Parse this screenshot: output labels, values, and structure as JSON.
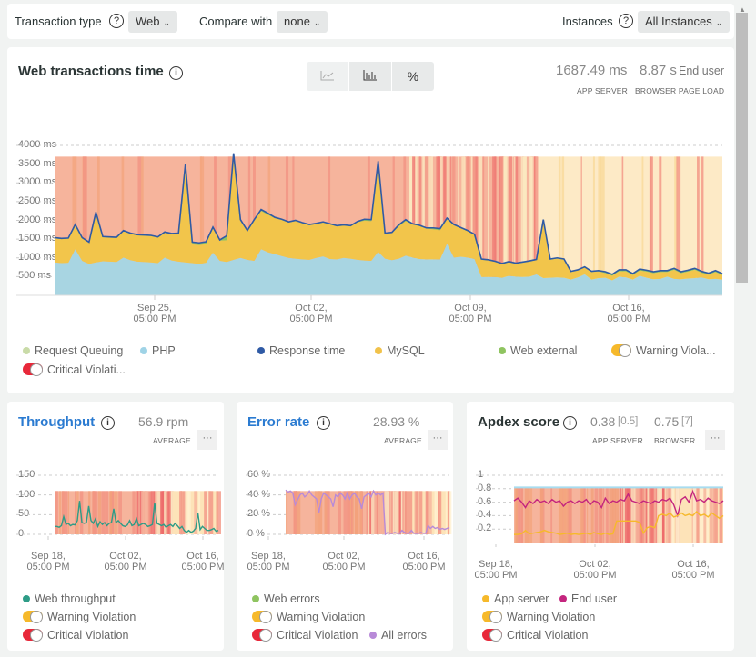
{
  "topbar": {
    "transaction_type_label": "Transaction type",
    "transaction_type_value": "Web",
    "compare_label": "Compare with",
    "compare_value": "none",
    "instances_label": "Instances",
    "instances_value": "All Instances",
    "help_glyph": "?",
    "chevron": "⌄"
  },
  "main": {
    "title": "Web transactions time",
    "info_glyph": "i",
    "view_buttons": [
      "area-chart",
      "bar-chart",
      "%"
    ],
    "percent_label": "%",
    "app_server_value": "1687.49 ms",
    "app_server_label": "APP SERVER",
    "browser_value": "8.87 s",
    "browser_suffix": "End user",
    "browser_label": "BROWSER PAGE LOAD",
    "legend": [
      {
        "label": "Request Queuing",
        "color": "#c9dba8",
        "type": "dot"
      },
      {
        "label": "PHP",
        "color": "#9fd3e6",
        "type": "dot"
      },
      {
        "label": "Response time",
        "color": "#2f5aa5",
        "type": "dot"
      },
      {
        "label": "MySQL",
        "color": "#f1c24a",
        "type": "dot"
      },
      {
        "label": "Web external",
        "color": "#8fc460",
        "type": "dot"
      },
      {
        "label": "Warning Viola...",
        "color": "#f6b92b",
        "type": "toggle"
      },
      {
        "label": "Critical Violati...",
        "color": "#e8283a",
        "type": "toggle"
      }
    ]
  },
  "throughput": {
    "title": "Throughput",
    "value": "56.9 rpm",
    "value_label": "AVERAGE",
    "more": "···",
    "legend": [
      {
        "label": "Web throughput",
        "color": "#2e9c87",
        "type": "dot"
      },
      {
        "label": "Warning Violation",
        "color": "#f6b92b",
        "type": "toggle"
      },
      {
        "label": "Critical Violation",
        "color": "#e8283a",
        "type": "toggle"
      }
    ]
  },
  "error_rate": {
    "title": "Error rate",
    "value": "28.93 %",
    "value_label": "AVERAGE",
    "more": "···",
    "legend": [
      {
        "label": "Web errors",
        "color": "#8fc460",
        "type": "dot"
      },
      {
        "label": "Warning Violation",
        "color": "#f6b92b",
        "type": "toggle"
      },
      {
        "label": "Critical Violation",
        "color": "#e8283a",
        "type": "toggle"
      },
      {
        "label": "All errors",
        "color": "#b88ad8",
        "type": "dot"
      }
    ]
  },
  "apdex": {
    "title": "Apdex score",
    "app_value": "0.38",
    "app_threshold": "[0.5]",
    "browser_value": "0.75",
    "browser_threshold": "[7]",
    "app_label": "APP SERVER",
    "browser_label": "BROWSER",
    "more": "···",
    "legend": [
      {
        "label": "App server",
        "color": "#f6b92b",
        "type": "dot"
      },
      {
        "label": "End user",
        "color": "#c4257e",
        "type": "dot"
      },
      {
        "label": "Warning Violation",
        "color": "#f6b92b",
        "type": "toggle"
      },
      {
        "label": "Critical Violation",
        "color": "#e8283a",
        "type": "toggle"
      }
    ]
  },
  "chart_data": [
    {
      "type": "area",
      "title": "Web transactions time",
      "ylabel": "ms",
      "ylim": [
        0,
        4000
      ],
      "yticks": [
        "4000 ms",
        "3500 ms",
        "3000 ms",
        "2500 ms",
        "2000 ms",
        "1500 ms",
        "1000 ms",
        "500 ms"
      ],
      "xticks": [
        "Sep 25,\n05:00 PM",
        "Oct 02,\n05:00 PM",
        "Oct 09,\n05:00 PM",
        "Oct 16,\n05:00 PM"
      ],
      "grid": true,
      "series": [
        {
          "name": "PHP",
          "color": "#a8d5e2",
          "values": [
            880,
            860,
            870,
            1230,
            920,
            840,
            880,
            910,
            900,
            890,
            1010,
            940,
            900,
            890,
            880,
            860,
            1010,
            930,
            900,
            880,
            860,
            840,
            870,
            1140,
            920,
            890,
            950,
            1000,
            950,
            920,
            1230,
            1150,
            1100,
            1050,
            1000,
            980,
            960,
            950,
            1000,
            1040,
            970,
            960,
            1000,
            980,
            950,
            930,
            920,
            1160,
            980,
            940,
            980,
            1060,
            1010,
            970,
            960,
            960,
            960,
            1380,
            1010,
            1030,
            1010,
            970,
            490,
            490,
            490,
            470,
            520,
            500,
            490,
            500,
            560,
            460,
            470,
            480,
            470,
            420,
            480,
            560,
            420,
            460,
            470,
            400,
            500,
            480,
            420,
            520,
            470,
            430,
            440,
            500,
            440,
            430,
            450,
            460,
            480,
            430,
            440,
            420
          ]
        },
        {
          "name": "MySQL",
          "color": "#f2c54b",
          "values": [
            640,
            640,
            640,
            640,
            600,
            560,
            1320,
            640,
            640,
            640,
            700,
            700,
            700,
            700,
            700,
            680,
            660,
            700,
            740,
            2600,
            500,
            500,
            500,
            660,
            540,
            580,
            2800,
            1000,
            760,
            1080,
            1020,
            1000,
            960,
            960,
            940,
            1000,
            960,
            920,
            900,
            900,
            920,
            880,
            860,
            860,
            1000,
            1060,
            1060,
            2400,
            660,
            720,
            860,
            920,
            880,
            880,
            820,
            800,
            780,
            660,
            860,
            760,
            700,
            640,
            460,
            440,
            400,
            360,
            360,
            340,
            380,
            400,
            380,
            1540,
            480,
            500,
            480,
            200,
            180,
            180,
            200,
            180,
            120,
            120,
            140,
            160,
            120,
            140,
            160,
            160,
            180,
            120,
            240,
            160,
            180,
            220,
            120,
            120,
            180,
            120,
            160,
            200
          ]
        },
        {
          "name": "Web external",
          "color": "#8fc460",
          "values": [
            20,
            20,
            20,
            20,
            20,
            20,
            20,
            20,
            20,
            20,
            20,
            20,
            20,
            20,
            20,
            20,
            20,
            20,
            20,
            20,
            60,
            60,
            60,
            20,
            20,
            120,
            40,
            20,
            20,
            20,
            40,
            40,
            20,
            20,
            20,
            20,
            20,
            20,
            20,
            20,
            20,
            20,
            20,
            20,
            20,
            40,
            40,
            20,
            20,
            20,
            40,
            40,
            20,
            20,
            20,
            40,
            40,
            20,
            20,
            20,
            20,
            20,
            20,
            20,
            20,
            20,
            20,
            20,
            20,
            20,
            20,
            20,
            20,
            20,
            20,
            20,
            20,
            20,
            20,
            20,
            40,
            40,
            40,
            40,
            40,
            40,
            40,
            40,
            40,
            40,
            40,
            40,
            40,
            40,
            40,
            40,
            40,
            40,
            40,
            40
          ]
        },
        {
          "name": "Response time",
          "color": "#2f5aa5",
          "line": true
        }
      ]
    },
    {
      "type": "line",
      "title": "Throughput",
      "ylim": [
        0,
        150
      ],
      "yticks": [
        "150",
        "100",
        "50",
        "0"
      ],
      "xticks": [
        "Sep 18,\n05:00 PM",
        "Oct 02,\n05:00 PM",
        "Oct 16,\n05:00 PM"
      ],
      "series": [
        {
          "name": "Web throughput",
          "color": "#2e9c87",
          "values": [
            20,
            20,
            18,
            22,
            45,
            25,
            28,
            22,
            25,
            24,
            35,
            85,
            30,
            28,
            30,
            72,
            35,
            28,
            40,
            20,
            32,
            25,
            30,
            22,
            28,
            30,
            65,
            30,
            35,
            28,
            22,
            20,
            24,
            35,
            22,
            25,
            40,
            22,
            25,
            28,
            25,
            20,
            22,
            25,
            80,
            28,
            25,
            22,
            25,
            18,
            22,
            25,
            20,
            28,
            22,
            15,
            20,
            10,
            5,
            10,
            5,
            8,
            15,
            55,
            12,
            20,
            15,
            10,
            10,
            12,
            15,
            8,
            10
          ]
        }
      ]
    },
    {
      "type": "line",
      "title": "Error rate",
      "ylim": [
        0,
        60
      ],
      "yticks": [
        "60 %",
        "40 %",
        "20 %",
        "0 %"
      ],
      "xticks": [
        "Sep 18,\n05:00 PM",
        "Oct 02,\n05:00 PM",
        "Oct 16,\n05:00 PM"
      ],
      "series": [
        {
          "name": "All errors",
          "color": "#b88ad8",
          "values": [
            45,
            43,
            44,
            42,
            30,
            35,
            40,
            42,
            38,
            40,
            44,
            40,
            38,
            36,
            22,
            36,
            42,
            40,
            38,
            36,
            28,
            40,
            38,
            42,
            40,
            36,
            42,
            36,
            40,
            42,
            38,
            36,
            26,
            38,
            40,
            42,
            38,
            44,
            40,
            42,
            40,
            42,
            0,
            2,
            1,
            1,
            2,
            1,
            1,
            4,
            2,
            1,
            1,
            4,
            1,
            1,
            1,
            2,
            1,
            1,
            9,
            6,
            8,
            6,
            7,
            5,
            6,
            5,
            6,
            7
          ]
        }
      ]
    },
    {
      "type": "line",
      "title": "Apdex score",
      "ylim": [
        0,
        1
      ],
      "yticks": [
        "1",
        "0.8",
        "0.6",
        "0.4",
        "0.2"
      ],
      "xticks": [
        "Sep 18,\n05:00 PM",
        "Oct 02,\n05:00 PM",
        "Oct 16,\n05:00 PM"
      ],
      "series": [
        {
          "name": "End user",
          "color": "#c4257e",
          "values": [
            0.62,
            0.66,
            0.6,
            0.52,
            0.62,
            0.58,
            0.64,
            0.6,
            0.62,
            0.58,
            0.64,
            0.6,
            0.62,
            0.54,
            0.6,
            0.62,
            0.58,
            0.62,
            0.6,
            0.64,
            0.56,
            0.62,
            0.6,
            0.52,
            0.66,
            0.58,
            0.62,
            0.6,
            0.64,
            0.62,
            0.72,
            0.62,
            0.6,
            0.58,
            0.62,
            0.6,
            0.58,
            0.62,
            0.6,
            0.64,
            0.62,
            0.66,
            0.56,
            0.4,
            0.64,
            0.68,
            0.6,
            0.76,
            0.62,
            0.64,
            0.6,
            0.66,
            0.62,
            0.6,
            0.58,
            0.62
          ]
        },
        {
          "name": "App server",
          "color": "#f6b92b",
          "values": [
            0.12,
            0.12,
            0.13,
            0.18,
            0.13,
            0.14,
            0.15,
            0.16,
            0.18,
            0.16,
            0.15,
            0.14,
            0.12,
            0.13,
            0.14,
            0.12,
            0.13,
            0.12,
            0.13,
            0.14,
            0.12,
            0.15,
            0.13,
            0.12,
            0.14,
            0.12,
            0.13,
            0.32,
            0.32,
            0.32,
            0.32,
            0.32,
            0.32,
            0.3,
            0.14,
            0.22,
            0.24,
            0.22,
            0.4,
            0.42,
            0.4,
            0.44,
            0.38,
            0.4,
            0.44,
            0.4,
            0.42,
            0.4,
            0.46,
            0.4,
            0.42,
            0.38,
            0.44,
            0.4,
            0.36,
            0.4
          ]
        }
      ]
    }
  ]
}
